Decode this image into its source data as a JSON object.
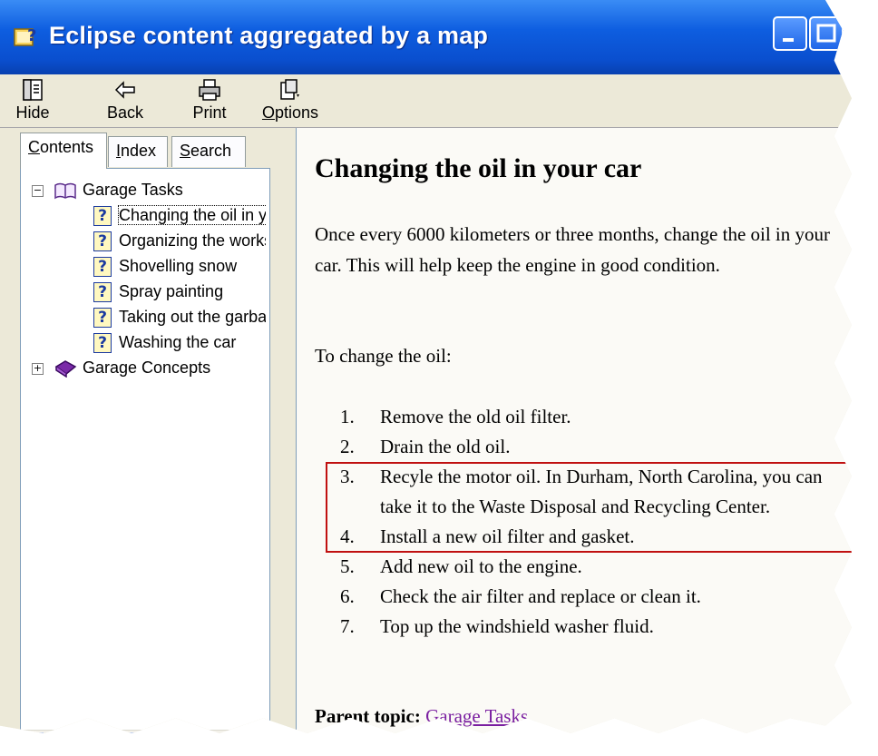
{
  "window": {
    "title": "Eclipse content aggregated by a map"
  },
  "toolbar": {
    "hide_label": "Hide",
    "back_label": "Back",
    "print_label": "Print",
    "options_label": "Options"
  },
  "nav": {
    "tabs": [
      {
        "label": "Contents",
        "accel": "C",
        "rest": "ontents"
      },
      {
        "label": "Index",
        "accel": "I",
        "rest": "ndex"
      },
      {
        "label": "Search",
        "accel": "S",
        "rest": "earch"
      }
    ],
    "tree": {
      "books": [
        {
          "label": "Garage Tasks",
          "expanded": true,
          "children": [
            "Changing the oil in your car",
            "Organizing the workspace",
            "Shovelling snow",
            "Spray painting",
            "Taking out the garbage",
            "Washing the car"
          ]
        },
        {
          "label": "Garage Concepts",
          "expanded": false,
          "children": []
        }
      ]
    }
  },
  "content": {
    "title": "Changing the oil in your car",
    "intro": "Once every 6000 kilometers or three months, change the oil in your car. This will help keep the engine in good condition.",
    "lead": "To change the oil:",
    "steps": [
      "Remove the old oil filter.",
      "Drain the old oil.",
      "Recyle the motor oil. In Durham, North Carolina, you can take it to the Waste Disposal and Recycling Center.",
      "Install a new oil filter and gasket.",
      "Add new oil to the engine.",
      "Check the air filter and replace or clean it.",
      "Top up the windshield washer fluid."
    ],
    "highlighted_step": 3,
    "parent_topic_label": "Parent topic:",
    "parent_topic_link": "Garage Tasks"
  },
  "colors": {
    "titlebar": "#0a4fcf",
    "highlight_border": "#c01010",
    "link": "#7a1ea0"
  }
}
